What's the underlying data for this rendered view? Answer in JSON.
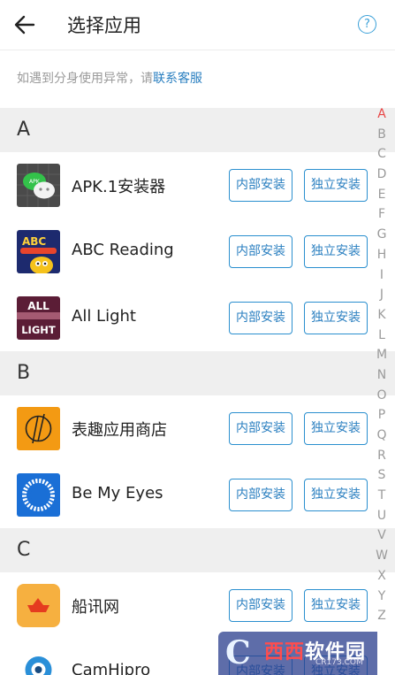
{
  "header": {
    "title": "选择应用",
    "help_icon": "?"
  },
  "notice": {
    "text": "如遇到分身使用异常，请",
    "link": "联系客服"
  },
  "buttons": {
    "internal": "内部安装",
    "standalone": "独立安装"
  },
  "sections": [
    {
      "letter": "A",
      "apps": [
        {
          "name": "APK.1安装器",
          "icon": "wechat-bubbles-icon"
        },
        {
          "name": "ABC Reading",
          "icon": "abc-reading-icon",
          "icon_text": "ABC"
        },
        {
          "name": "All Light",
          "icon": "all-light-icon",
          "icon_text": [
            "ALL",
            "LIGHT"
          ]
        }
      ]
    },
    {
      "letter": "B",
      "apps": [
        {
          "name": "表趣应用商店",
          "icon": "biaoqu-store-icon"
        },
        {
          "name": "Be My Eyes",
          "icon": "be-my-eyes-icon"
        }
      ]
    },
    {
      "letter": "C",
      "apps": [
        {
          "name": "船讯网",
          "icon": "chuanxun-boat-icon"
        },
        {
          "name": "CamHipro",
          "icon": "camhipro-icon"
        }
      ]
    }
  ],
  "alphabet": [
    "A",
    "B",
    "C",
    "D",
    "E",
    "F",
    "G",
    "H",
    "I",
    "J",
    "K",
    "L",
    "M",
    "N",
    "O",
    "P",
    "Q",
    "R",
    "S",
    "T",
    "U",
    "V",
    "W",
    "X",
    "Y",
    "Z"
  ],
  "alphabet_active": "A",
  "watermark": {
    "c": "C",
    "xixi": "西西",
    "rest": "软件园",
    "url": "CR173.COM"
  },
  "colors": {
    "accent": "#2a7fc0",
    "index_active": "#e84545"
  }
}
